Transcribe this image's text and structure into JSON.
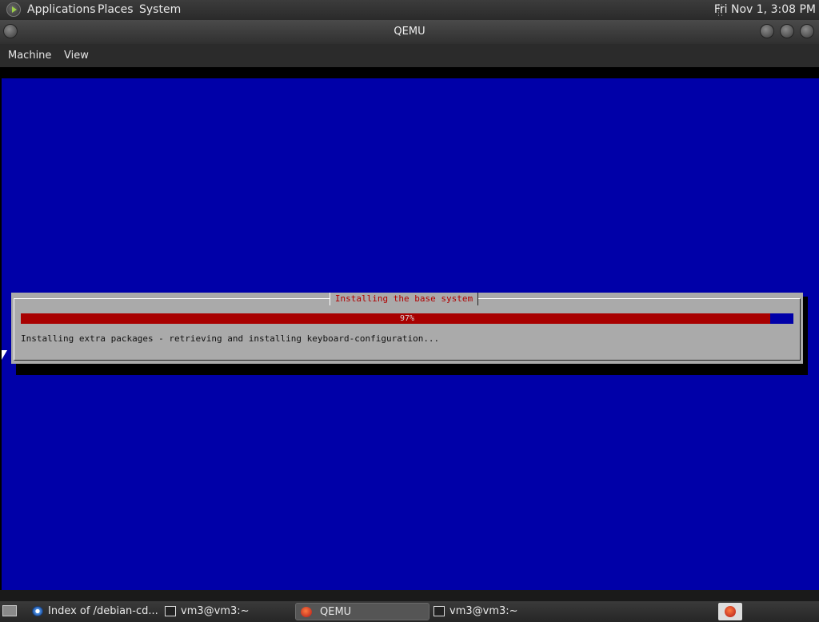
{
  "top_panel": {
    "menus": [
      "Applications",
      "Places",
      "System"
    ],
    "clock": "Fri Nov 1,  3:08 PM"
  },
  "window": {
    "title": "QEMU",
    "menu": [
      "Machine",
      "View"
    ]
  },
  "installer": {
    "dialog_title": "Installing the base system",
    "progress_percent": 97,
    "progress_label": "97%",
    "status": "Installing extra packages - retrieving and installing keyboard-configuration...",
    "colors": {
      "screen": "#0000a8",
      "dialog": "#aaaaaa",
      "progress": "#a80000",
      "title": "#b00000"
    }
  },
  "taskbar": {
    "tasks": [
      {
        "label": "Index of /debian-cd...",
        "icon": "browser-icon"
      },
      {
        "label": "vm3@vm3:~",
        "icon": "terminal-icon"
      },
      {
        "label": "QEMU",
        "icon": "qemu-icon",
        "active": true
      },
      {
        "label": "vm3@vm3:~",
        "icon": "terminal-icon"
      }
    ]
  }
}
